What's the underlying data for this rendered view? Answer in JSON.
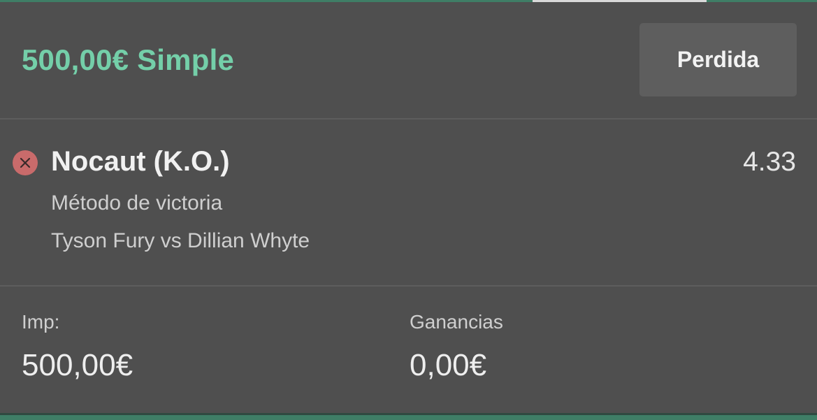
{
  "header": {
    "bet_title": "500,00€ Simple",
    "status_label": "Perdida"
  },
  "selection": {
    "result_icon": "lost-x-icon",
    "name": "Nocaut (K.O.)",
    "odds": "4.33",
    "market": "Método de victoria",
    "event": "Tyson Fury vs Dillian Whyte"
  },
  "footer": {
    "stake_label": "Imp:",
    "stake_value": "500,00€",
    "returns_label": "Ganancias",
    "returns_value": "0,00€"
  },
  "colors": {
    "accent_green": "#74cfa9",
    "background": "#4f4f4f",
    "lost_red": "#c96b6b",
    "button_bg": "#5e5e5e"
  }
}
